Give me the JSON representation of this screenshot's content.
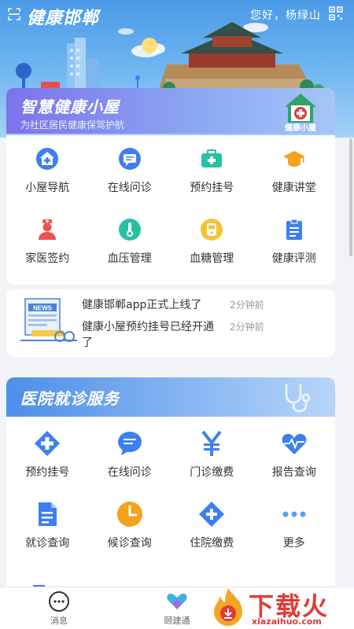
{
  "header": {
    "app_title": "健康邯郸",
    "greeting": "您好，杨绿山"
  },
  "banner": {
    "title": "智慧健康小屋",
    "subtitle": "为社区居民健康保驾护航",
    "logo_text": "健康小屋"
  },
  "community_services": [
    {
      "label": "小屋导航",
      "icon": "house-plus-icon",
      "color": "#3d7ff0"
    },
    {
      "label": "在线问诊",
      "icon": "chat-icon",
      "color": "#3d7ff0"
    },
    {
      "label": "预约挂号",
      "icon": "medkit-icon",
      "color": "#27c0a3"
    },
    {
      "label": "健康讲堂",
      "icon": "graduation-cap-icon",
      "color": "#f4a21c"
    },
    {
      "label": "家医签约",
      "icon": "doctor-icon",
      "color": "#ef5350"
    },
    {
      "label": "血压管理",
      "icon": "thermometer-icon",
      "color": "#27c0a3"
    },
    {
      "label": "血糖管理",
      "icon": "glucose-meter-icon",
      "color": "#f4c430"
    },
    {
      "label": "健康评测",
      "icon": "clipboard-icon",
      "color": "#3d7ff0"
    }
  ],
  "news": [
    {
      "title": "健康邯郸app正式上线了",
      "time": "2分钟前"
    },
    {
      "title": "健康小屋预约挂号已经开通了",
      "time": "2分钟前"
    }
  ],
  "news_image_label": "NEWS",
  "hospital": {
    "title": "医院就诊服务",
    "items": [
      {
        "label": "预约挂号",
        "icon": "medical-cross-icon",
        "color": "#3d7ff0"
      },
      {
        "label": "在线问诊",
        "icon": "chat-bubble-icon",
        "color": "#3d7ff0"
      },
      {
        "label": "门诊缴费",
        "icon": "yuan-icon",
        "color": "#3d7ff0"
      },
      {
        "label": "报告查询",
        "icon": "heart-pulse-icon",
        "color": "#3d7ff0"
      },
      {
        "label": "就诊查询",
        "icon": "document-icon",
        "color": "#3d7ff0"
      },
      {
        "label": "候诊查询",
        "icon": "clock-icon",
        "color": "#f4a21c"
      },
      {
        "label": "住院缴费",
        "icon": "plus-diamond-icon",
        "color": "#3d7ff0"
      },
      {
        "label": "更多",
        "icon": "more-dots-icon",
        "color": "#5b9cf5"
      }
    ]
  },
  "bottom_nav": [
    {
      "label": "消息",
      "icon": "message-icon"
    },
    {
      "label": "颐建通",
      "icon": "heart-logo-icon"
    }
  ],
  "watermark": {
    "text": "下载火",
    "url": "xiazaihuo.com"
  }
}
